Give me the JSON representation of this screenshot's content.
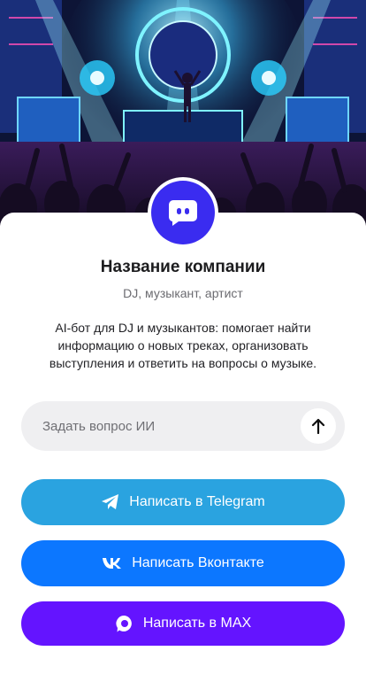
{
  "profile": {
    "title": "Название компании",
    "subtitle": "DJ, музыкант, артист",
    "description": "AI-бот для DJ и музыкантов: помогает найти информацию о новых треках, организовать выступления и ответить на вопросы о музыке."
  },
  "ask": {
    "placeholder": "Задать вопрос ИИ",
    "value": ""
  },
  "buttons": {
    "telegram": "Написать в Telegram",
    "vk": "Написать Вконтакте",
    "max": "Написать в MAX"
  },
  "icons": {
    "avatar": "chat-bot-icon",
    "send": "arrow-up-icon",
    "telegram": "telegram-icon",
    "vk": "vk-icon",
    "max": "max-icon"
  },
  "colors": {
    "avatar": "#3a2cf0",
    "telegram": "#2aa3e0",
    "vk": "#0c77ff",
    "max": "#6414ff",
    "input_bg": "#efeff1"
  }
}
